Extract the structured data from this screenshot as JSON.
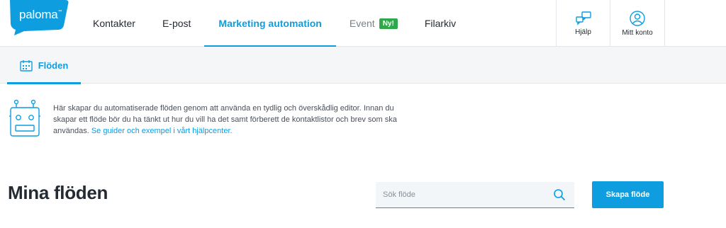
{
  "brand": {
    "logo_text": "paloma",
    "logo_mark": "™",
    "accent_color": "#0e9ee0",
    "badge_color": "#2ea84a"
  },
  "nav": {
    "items": [
      {
        "label": "Kontakter"
      },
      {
        "label": "E-post"
      },
      {
        "label": "Marketing automation",
        "active": true
      },
      {
        "label": "Event",
        "badge": "Ny!"
      },
      {
        "label": "Filarkiv"
      }
    ]
  },
  "tools": {
    "help_label": "Hjälp",
    "help_icon": "chat-bubbles-icon",
    "account_label": "Mitt konto",
    "account_icon": "user-icon"
  },
  "subnav": {
    "tab_label": "Flöden",
    "tab_icon": "calendar-icon"
  },
  "info": {
    "icon": "robot-icon",
    "text": "Här skapar du automatiserade flöden genom att använda en tydlig och överskådlig editor. Innan du skapar ett flöde bör du ha tänkt ut hur du vill ha det samt förberett de kontaktlistor och brev som ska användas. ",
    "link_text": "Se guider och exempel i vårt hjälpcenter."
  },
  "main": {
    "title": "Mina flöden",
    "search_placeholder": "Sök flöde",
    "search_icon": "search-icon",
    "create_label": "Skapa flöde"
  }
}
